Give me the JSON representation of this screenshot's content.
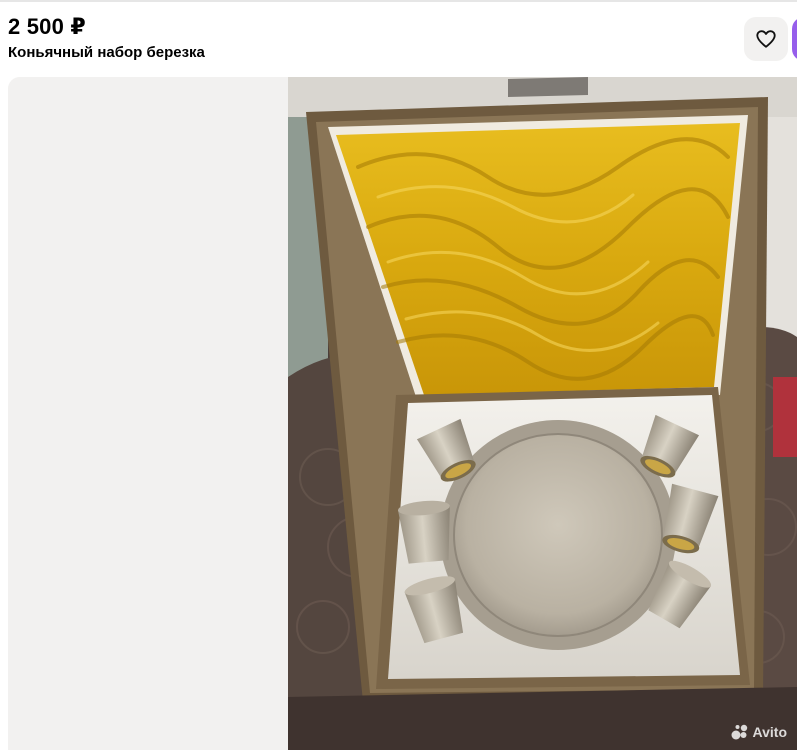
{
  "listing": {
    "price": "2 500 ₽",
    "title": "Коньячный набор березка"
  },
  "actions": {
    "favorite_icon": "heart-icon"
  },
  "photo": {
    "watermark": "Avito",
    "watermark_icon": "avito-logo-icon"
  },
  "colors": {
    "accent": "#965eeb",
    "button_bg": "#f2f1f0",
    "lining": "#e2b41a",
    "silver": "#c8c1b3"
  }
}
